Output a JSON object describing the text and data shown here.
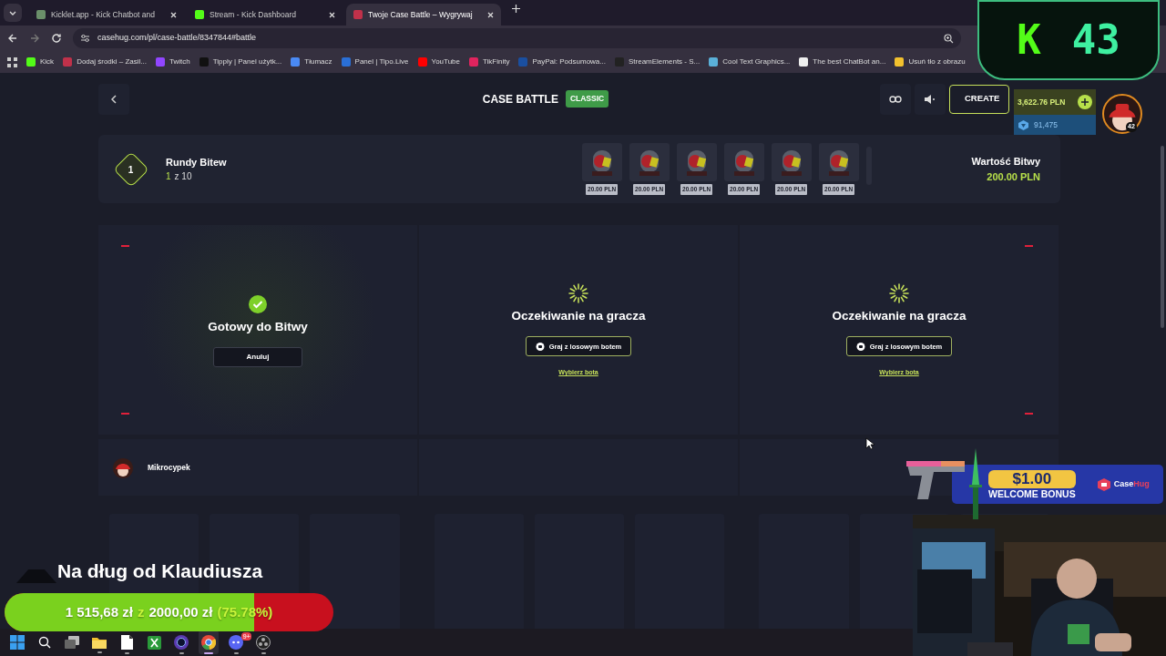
{
  "browser": {
    "tabs": [
      {
        "title": "Kicklet.app - Kick Chatbot and",
        "selected": false,
        "color": "#6a8f6a"
      },
      {
        "title": "Stream - Kick Dashboard",
        "selected": false,
        "color": "#53fc18"
      },
      {
        "title": "Twoje Case Battle – Wygrywaj",
        "selected": true,
        "color": "#c0314a"
      }
    ],
    "address": "casehug.com/pl/case-battle/8347844#battle",
    "bookmarks": [
      {
        "label": "Kick",
        "color": "#53fc18"
      },
      {
        "label": "Dodaj środki – Zasil...",
        "color": "#c0314a"
      },
      {
        "label": "Twitch",
        "color": "#9146ff"
      },
      {
        "label": "Tipply | Panel użytk...",
        "color": "#111111"
      },
      {
        "label": "Tłumacz",
        "color": "#4a8af4"
      },
      {
        "label": "Panel | Tipo.Live",
        "color": "#2a6fd6"
      },
      {
        "label": "YouTube",
        "color": "#ff0000"
      },
      {
        "label": "TikFinity",
        "color": "#e0245e"
      },
      {
        "label": "PayPal: Podsumowa...",
        "color": "#1a4fa0"
      },
      {
        "label": "StreamElements - S...",
        "color": "#222222"
      },
      {
        "label": "Cool Text Graphics...",
        "color": "#5ab0d8"
      },
      {
        "label": "The best ChatBot an...",
        "color": "#eeeeee"
      },
      {
        "label": "Usuń tło z obrazu",
        "color": "#f2c12e"
      }
    ]
  },
  "header": {
    "title": "CASE BATTLE",
    "mode": "CLASSIC",
    "create_button": "CREATE"
  },
  "rounds": {
    "current": "1",
    "label": "Rundy Bitew",
    "progress_current": "1",
    "progress_rest": "z 10",
    "cases": [
      {
        "price": "20.00 PLN"
      },
      {
        "price": "20.00 PLN"
      },
      {
        "price": "20.00 PLN"
      },
      {
        "price": "20.00 PLN"
      },
      {
        "price": "20.00 PLN"
      },
      {
        "price": "20.00 PLN"
      }
    ],
    "value_label": "Wartość Bitwy",
    "value": "200.00 PLN"
  },
  "slots": [
    {
      "kind": "ready",
      "status": "Gotowy do Bitwy",
      "button": "Anuluj"
    },
    {
      "kind": "waiting",
      "status": "Oczekiwanie na gracza",
      "button": "Graj z losowym botem",
      "link": "Wybierz bota"
    },
    {
      "kind": "waiting",
      "status": "Oczekiwanie na gracza",
      "button": "Graj z losowym botem",
      "link": "Wybierz bota"
    }
  ],
  "players": [
    {
      "name": "Mikrocypek"
    }
  ],
  "balance": {
    "amount": "3,622.76 PLN",
    "gems": "91,475",
    "user_level": "42"
  },
  "stream_overlay": {
    "counter": {
      "logo": "K",
      "value": "43"
    },
    "goal": {
      "title": "Na dług od Klaudiusza",
      "raised": "1 515,68 zł",
      "of": "z",
      "target": "2000,00 zł",
      "percent": "(75.78%)",
      "level": 0.7578
    },
    "promo": {
      "amount": "$1.00",
      "caption": "WELCOME BONUS",
      "brand": "Case",
      "brand_accent": "Hug"
    }
  },
  "taskbar": {
    "apps": [
      {
        "kind": "windows",
        "running": false,
        "selected": false
      },
      {
        "kind": "search",
        "running": false,
        "selected": false
      },
      {
        "kind": "taskview",
        "running": false,
        "selected": false
      },
      {
        "kind": "folder",
        "running": true,
        "selected": false
      },
      {
        "kind": "files",
        "running": true,
        "selected": false
      },
      {
        "kind": "xbox",
        "running": false,
        "selected": false
      },
      {
        "kind": "ring",
        "running": true,
        "selected": false
      },
      {
        "kind": "chrome",
        "running": true,
        "selected": true
      },
      {
        "kind": "discord",
        "running": true,
        "selected": false,
        "badge": "9+"
      },
      {
        "kind": "obs",
        "running": true,
        "selected": false
      }
    ]
  }
}
